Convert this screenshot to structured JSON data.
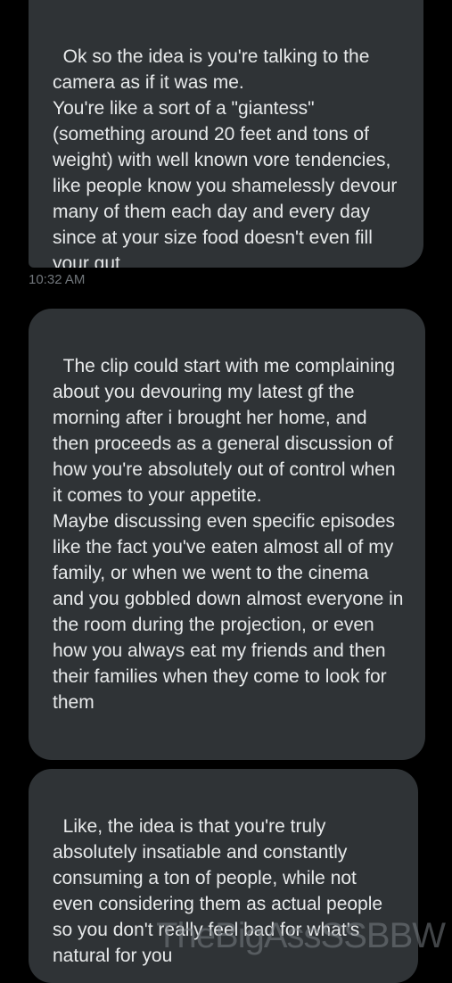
{
  "messages": [
    {
      "text": "Ok so the idea is you're talking to the camera as if it was me.\nYou're like a sort of a \"giantess\" (something around 20 feet and tons of weight) with well known vore tendencies, like people know you shamelessly devour many of them each day and every day since at your size food doesn't even fill your gut",
      "timestamp": "10:32 AM"
    },
    {
      "text": "The clip could start with me complaining about you devouring my latest gf the morning after i brought her home, and then proceeds as a general discussion of how you're absolutely out of control when it comes to your appetite.\nMaybe discussing even specific episodes like the fact you've eaten almost all of my family, or when we went to the cinema and you gobbled down almost everyone in the room during the projection, or even how you always eat my friends and then their families when they come to look for them"
    },
    {
      "text": "Like, the idea is that you're truly absolutely insatiable and constantly consuming a ton of people, while not even considering them as actual people so you don't really feel bad for what's natural for you"
    }
  ],
  "watermark": "TheBigAssSSBBW",
  "colors": {
    "background": "#000000",
    "bubble": "#2f3336",
    "text": "#e7e9ea",
    "timestamp": "#71767b"
  }
}
